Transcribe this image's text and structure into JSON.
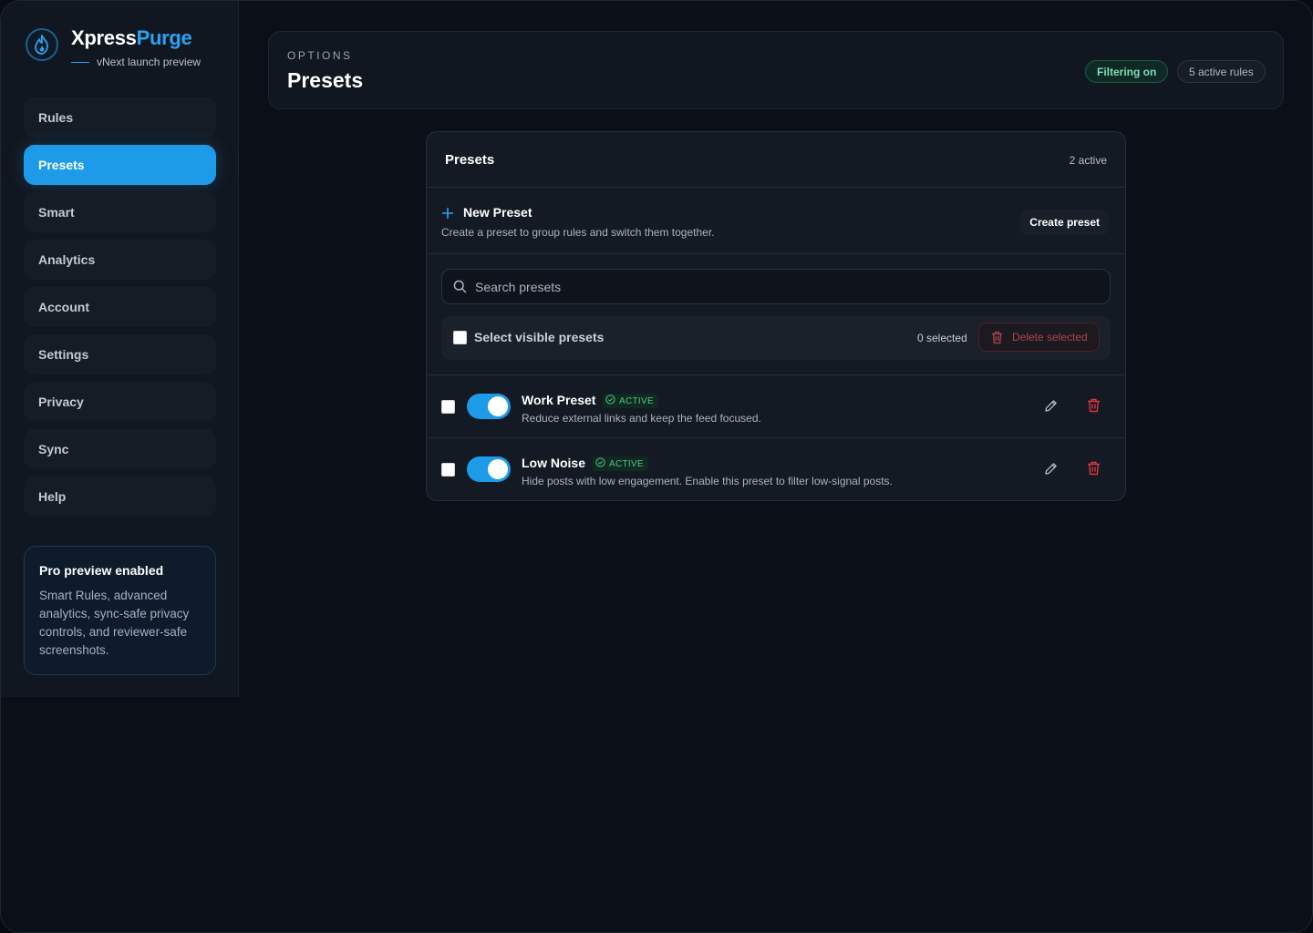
{
  "brand": {
    "name_part1": "Xpress",
    "name_part2": "Purge",
    "subtitle": "vNext launch preview"
  },
  "sidebar": {
    "items": [
      {
        "label": "Rules"
      },
      {
        "label": "Presets",
        "active": true
      },
      {
        "label": "Smart"
      },
      {
        "label": "Analytics"
      },
      {
        "label": "Account"
      },
      {
        "label": "Settings"
      },
      {
        "label": "Privacy"
      },
      {
        "label": "Sync"
      },
      {
        "label": "Help"
      }
    ],
    "pro_card": {
      "title": "Pro preview enabled",
      "body": "Smart Rules, advanced analytics, sync-safe privacy controls, and reviewer-safe screenshots."
    }
  },
  "header": {
    "eyebrow": "OPTIONS",
    "title": "Presets",
    "filter_pill": "Filtering on",
    "rules_pill": "5 active rules"
  },
  "panel": {
    "title": "Presets",
    "count": "2 active",
    "new_preset": {
      "title": "New Preset",
      "description": "Create a preset to group rules and switch them together.",
      "button": "Create preset"
    },
    "search": {
      "placeholder": "Search presets",
      "value": ""
    },
    "select_bar": {
      "label": "Select visible presets",
      "count": "0 selected",
      "delete_button": "Delete selected"
    },
    "presets": [
      {
        "name": "Work Preset",
        "badge": "ACTIVE",
        "description": "Reduce external links and keep the feed focused.",
        "enabled": true,
        "checked": false
      },
      {
        "name": "Low Noise",
        "badge": "ACTIVE",
        "description": "Hide posts with low engagement. Enable this preset to filter low-signal posts.",
        "enabled": true,
        "checked": false
      }
    ]
  },
  "colors": {
    "accent": "#1e9be8",
    "brand_blue": "#2aa3f2",
    "success": "#47c98c",
    "danger": "#e0343c",
    "background": "#0a0f18"
  },
  "icons": {
    "logo": "flame-icon",
    "search": "search-icon",
    "plus": "plus-icon",
    "trash": "trash-icon",
    "edit": "pencil-icon",
    "active": "check-circle-icon"
  }
}
